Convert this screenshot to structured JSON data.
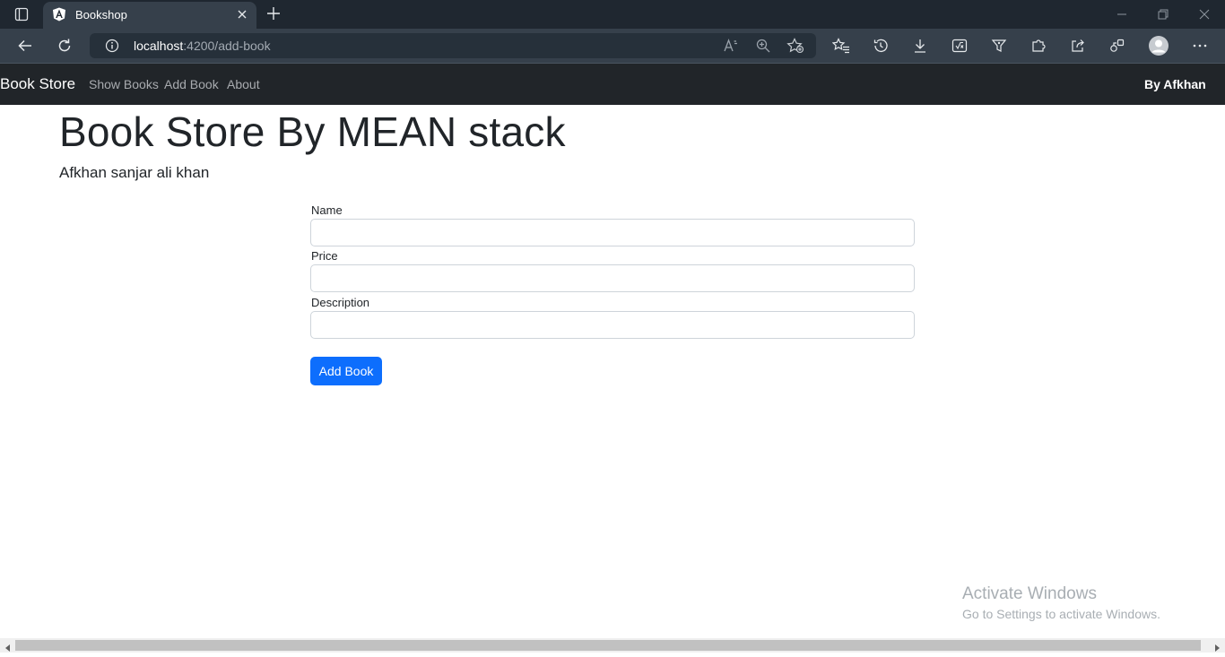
{
  "browser": {
    "tab_title": "Bookshop",
    "url_host": "localhost",
    "url_path": ":4200/add-book"
  },
  "navbar": {
    "brand": "Book Store",
    "links": [
      "Show Books",
      "Add Book",
      "About"
    ],
    "right_text": "By Afkhan"
  },
  "page": {
    "title": "Book Store By MEAN stack",
    "subtitle": "Afkhan sanjar ali khan"
  },
  "form": {
    "name_label": "Name",
    "name_value": "",
    "price_label": "Price",
    "price_value": "",
    "description_label": "Description",
    "description_value": "",
    "submit_label": "Add Book"
  },
  "watermark": {
    "title": "Activate Windows",
    "subtitle": "Go to Settings to activate Windows."
  },
  "colors": {
    "navbar_bg": "#212529",
    "primary_button": "#0d6efd",
    "browser_toolbar": "#36404b"
  }
}
